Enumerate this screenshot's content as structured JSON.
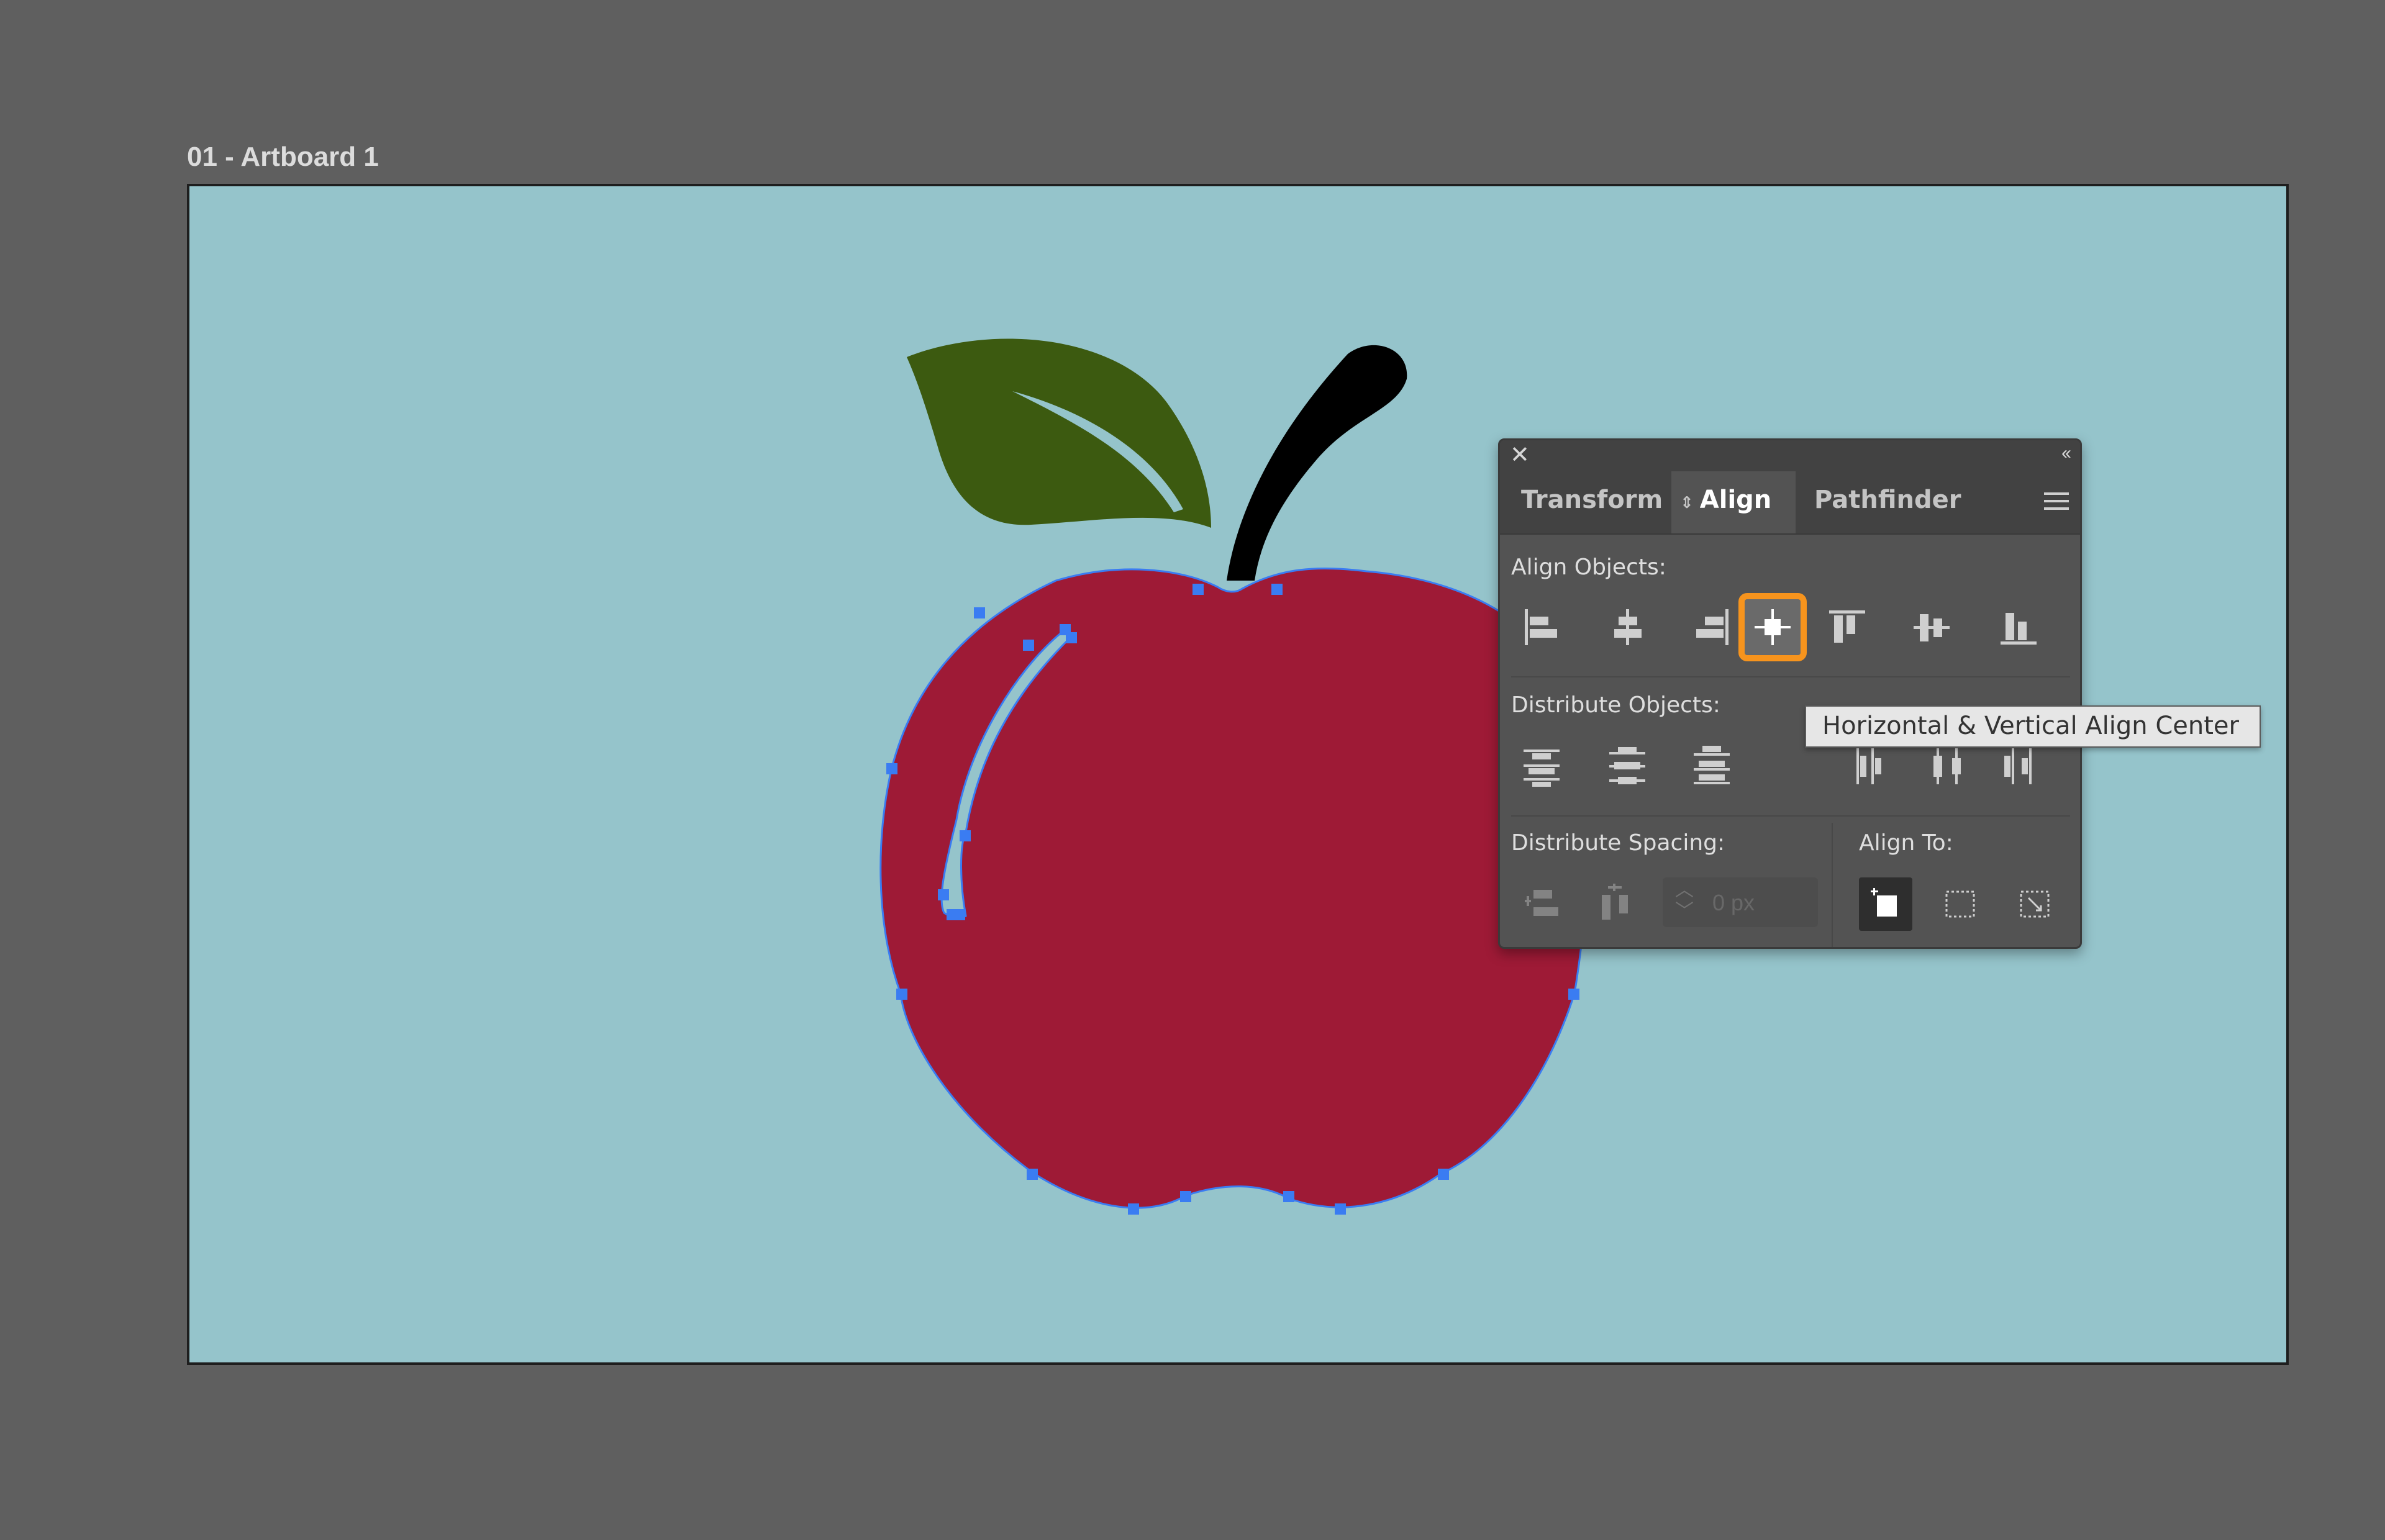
{
  "artboard": {
    "label": "01 - Artboard 1"
  },
  "colors": {
    "canvas": "#5f5f5f",
    "artboard_fill": "#95c4cb",
    "apple_red": "#9e1a36",
    "leaf_green": "#3c5a10",
    "stem": "#000000",
    "selection_blue": "#3a7cf2",
    "highlight_orange": "#f7941d",
    "panel_bg": "#535353"
  },
  "panel": {
    "tabs": [
      {
        "label": "Transform"
      },
      {
        "label": "Align",
        "active": true
      },
      {
        "label": "Pathfinder"
      }
    ],
    "close_icon": "close-icon",
    "collapse_icon": "double-chevron-left-icon",
    "menu_icon": "hamburger-menu-icon",
    "sections": {
      "align_objects": "Align Objects:",
      "distribute_objects": "Distribute Objects:",
      "distribute_spacing": "Distribute Spacing:",
      "align_to": "Align To:"
    },
    "spacing_value": "0 px",
    "highlighted_button": "horizontal-vertical-align-center-button"
  },
  "tooltip": {
    "text": "Horizontal & Vertical Align Center"
  }
}
